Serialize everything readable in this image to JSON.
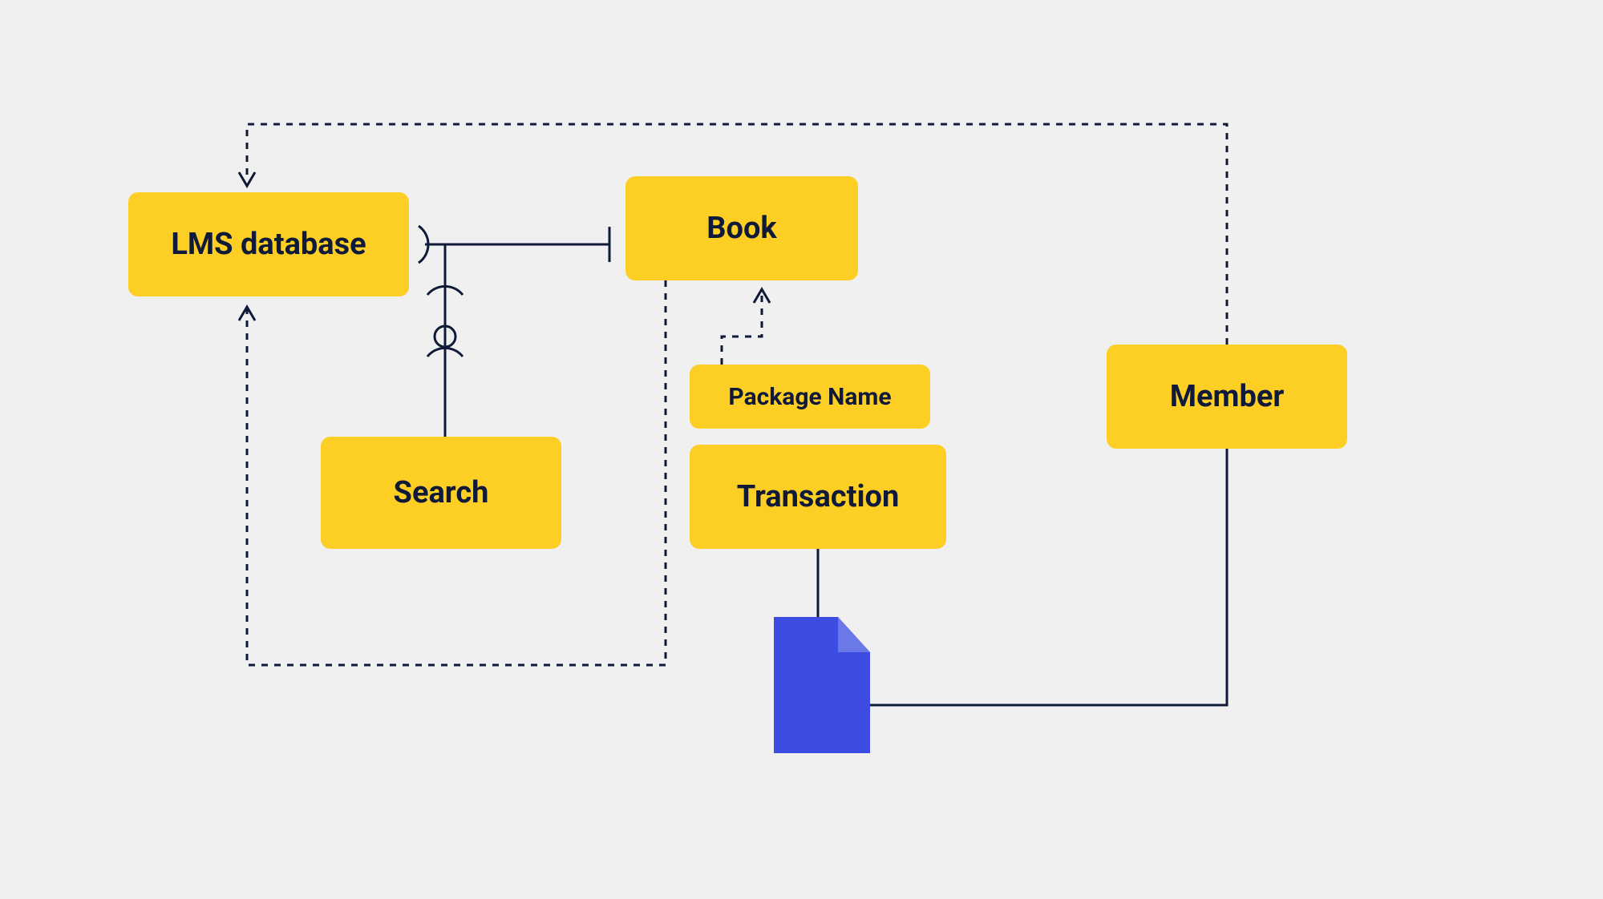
{
  "diagram": {
    "nodes": {
      "lms": {
        "label": "LMS database"
      },
      "book": {
        "label": "Book"
      },
      "search": {
        "label": "Search"
      },
      "package": {
        "label": "Package Name"
      },
      "transaction": {
        "label": "Transaction"
      },
      "member": {
        "label": "Member"
      }
    },
    "colors": {
      "node_fill": "#FDCF25",
      "line": "#0F1938",
      "background": "#f0f0f0",
      "file_icon": "#3C4CE0"
    }
  }
}
